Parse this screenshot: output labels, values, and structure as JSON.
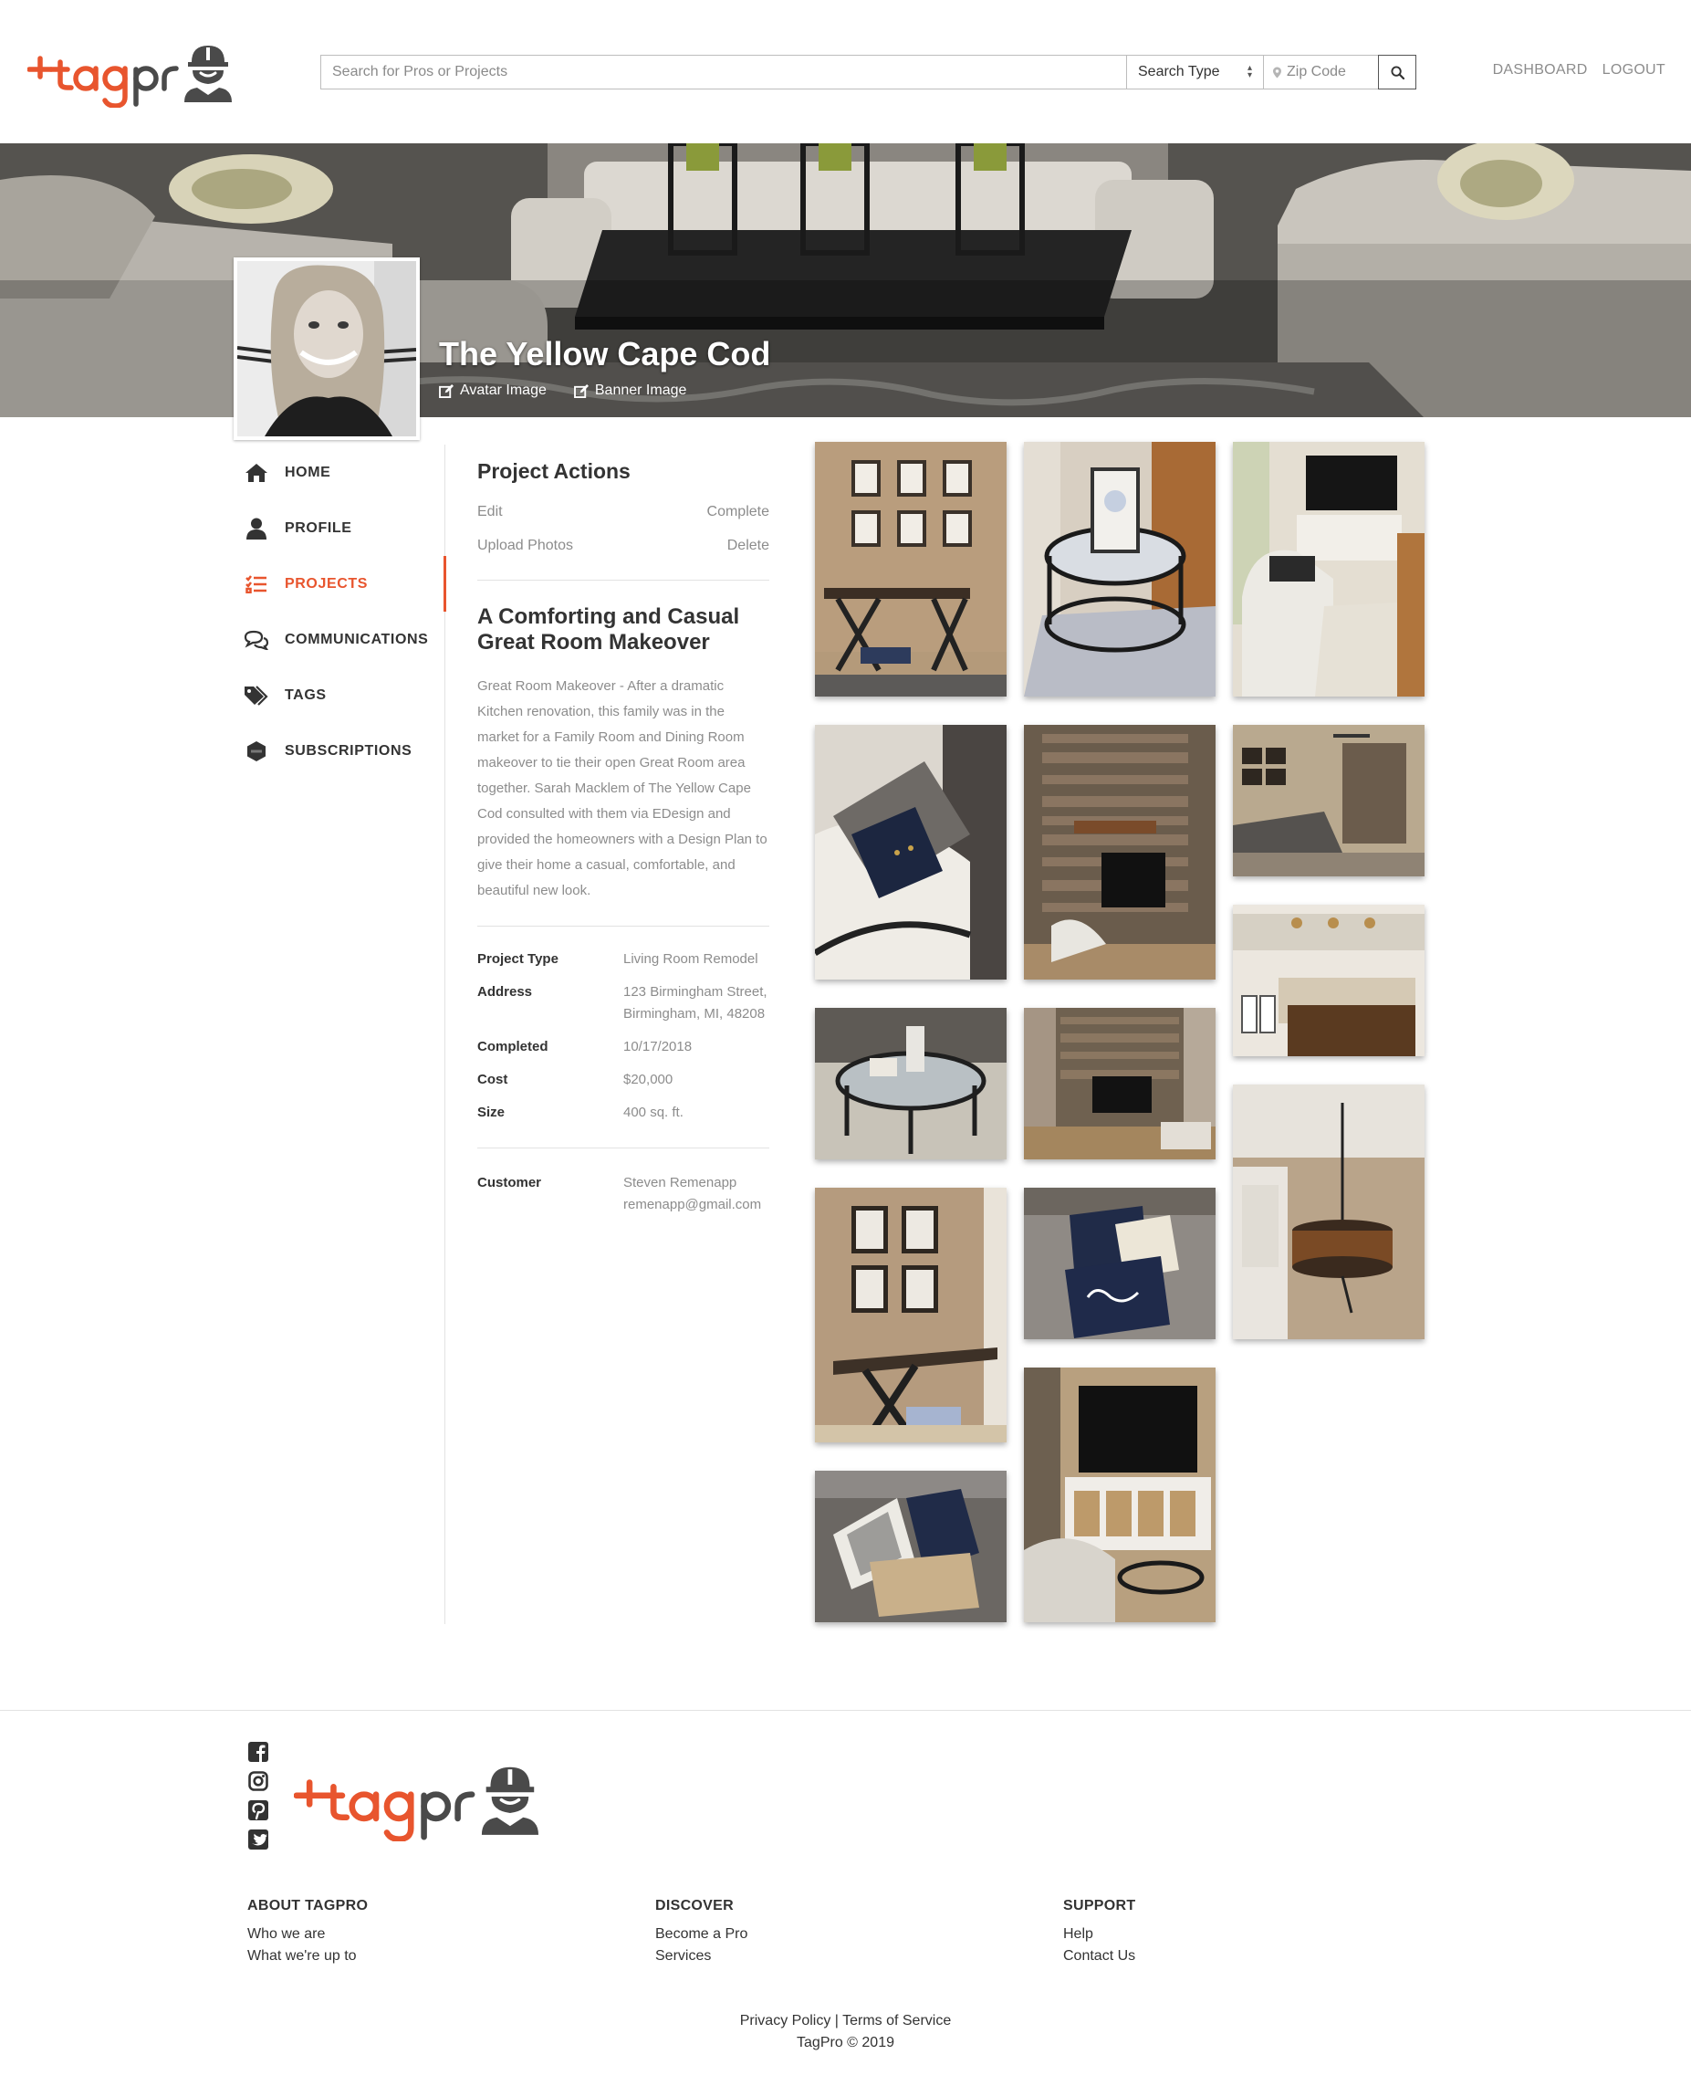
{
  "brand": {
    "name": "tagpro",
    "accent": "#e8552e",
    "dark": "#4a4a4a"
  },
  "header": {
    "search_placeholder": "Search for Pros or Projects",
    "search_type": "Search Type",
    "zip_placeholder": "Zip Code",
    "nav": {
      "dashboard": "DASHBOARD",
      "logout": "LOGOUT"
    }
  },
  "banner": {
    "title": "The Yellow Cape Cod",
    "avatar_link": "Avatar Image",
    "banner_link": "Banner Image"
  },
  "sidebar": {
    "items": [
      {
        "label": "HOME",
        "icon": "home-icon"
      },
      {
        "label": "PROFILE",
        "icon": "user-icon"
      },
      {
        "label": "PROJECTS",
        "icon": "tasks-icon",
        "active": true
      },
      {
        "label": "COMMUNICATIONS",
        "icon": "comments-icon"
      },
      {
        "label": "TAGS",
        "icon": "tags-icon"
      },
      {
        "label": "SUBSCRIPTIONS",
        "icon": "pro-badge-icon"
      }
    ]
  },
  "project": {
    "actions_title": "Project Actions",
    "actions": {
      "edit": "Edit",
      "complete": "Complete",
      "upload": "Upload Photos",
      "delete": "Delete"
    },
    "title": "A Comforting and Casual Great Room Makeover",
    "description": "Great Room Makeover - After a dramatic Kitchen renovation, this family was in the market for a Family Room and Dining Room makeover to tie their open Great Room area together. Sarah Macklem of The Yellow Cape Cod consulted with them via EDesign and provided the homeowners with a Design Plan to give their home a casual, comfortable, and beautiful new look.",
    "facts": {
      "type_label": "Project Type",
      "type": "Living Room Remodel",
      "address_label": "Address",
      "address": "123 Birmingham Street, Birmingham, MI, 48208",
      "completed_label": "Completed",
      "completed": "10/17/2018",
      "cost_label": "Cost",
      "cost": "$20,000",
      "size_label": "Size",
      "size": "400 sq. ft."
    },
    "customer": {
      "label": "Customer",
      "name": "Steven Remenapp",
      "email": "remenapp@gmail.com"
    }
  },
  "gallery": {
    "photos": [
      "gallery-wall-console",
      "round-glass-table",
      "chaise-tv-room",
      "pillow-closeup",
      "stone-fireplace",
      "living-room-overview",
      "kitchen-island",
      "glass-table-rug",
      "fireplace-wide",
      "pendant-light",
      "frames-bench",
      "home-pillow",
      "sofa-pillows",
      "tv-console-chair"
    ]
  },
  "footer": {
    "columns": [
      {
        "title": "ABOUT TAGPRO",
        "links": [
          "Who we are",
          "What we're up to"
        ]
      },
      {
        "title": "DISCOVER",
        "links": [
          "Become a Pro",
          "Services"
        ]
      },
      {
        "title": "SUPPORT",
        "links": [
          "Help",
          "Contact Us"
        ]
      }
    ],
    "privacy": "Privacy Policy",
    "divider": "|",
    "terms": "Terms of Service",
    "copyright": "TagPro © 2019"
  }
}
